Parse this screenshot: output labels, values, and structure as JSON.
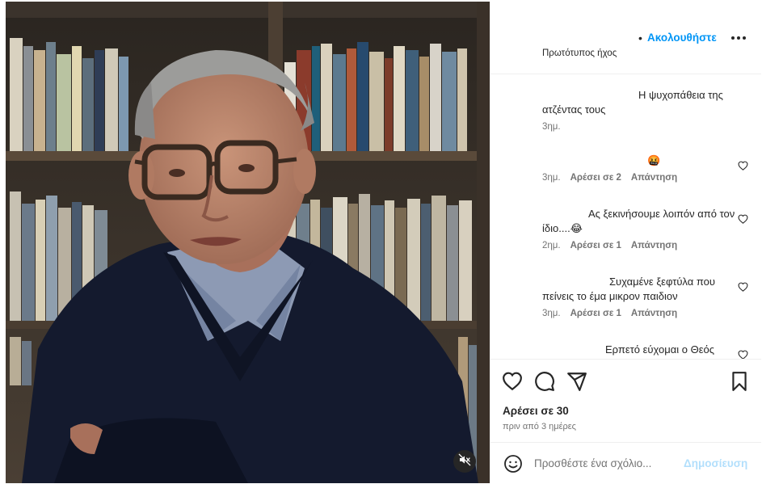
{
  "header": {
    "follow_dot": "•",
    "follow_label": "Ακολουθήστε",
    "audio_label": "Πρωτότυπος ήχος"
  },
  "comments": [
    {
      "text": "Η ψυχοπάθεια της ατζέντας τους",
      "time": "3ημ.",
      "likes": "",
      "reply": ""
    },
    {
      "text": "🤬",
      "time": "3ημ.",
      "likes": "Αρέσει σε 2",
      "reply": "Απάντηση"
    },
    {
      "text": "Ας ξεκινήσουμε λοιπόν από τον ίδιο....😂",
      "time": "2ημ.",
      "likes": "Αρέσει σε 1",
      "reply": "Απάντηση"
    },
    {
      "text": "Συχαμένε ξεφτύλα που πείνεις το έμα μικρον παιδιον",
      "time": "3ημ.",
      "likes": "Αρέσει σε 1",
      "reply": "Απάντηση"
    },
    {
      "text": "Ερπετό εύχομαι ο Θεός",
      "time": "",
      "likes": "",
      "reply": ""
    }
  ],
  "post": {
    "likes_label": "Αρέσει σε 30",
    "posted_label": "πριν από 3 ημέρες"
  },
  "composer": {
    "placeholder": "Προσθέστε ένα σχόλιο...",
    "post_label": "Δημοσίευση"
  },
  "icons": {
    "like": "heart-icon",
    "comment": "comment-icon",
    "share": "share-icon",
    "save": "bookmark-icon",
    "mute": "speaker-muted-icon",
    "emoji": "emoji-icon",
    "more": "more-icon"
  },
  "colors": {
    "accent": "#0095f6",
    "post_disabled": "#b2dffc",
    "secondary_text": "#737373",
    "divider": "#efefef"
  }
}
